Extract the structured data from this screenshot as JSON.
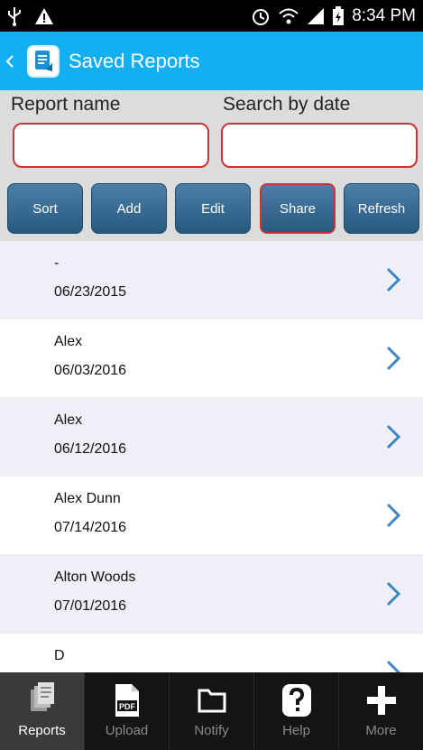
{
  "status_bar": {
    "time": "8:34 PM",
    "icons": [
      "usb-icon",
      "warning-icon",
      "alarm-icon",
      "wifi-icon",
      "signal-icon",
      "battery-icon"
    ]
  },
  "header": {
    "title": "Saved Reports"
  },
  "search": {
    "report_name_label": "Report name",
    "report_name_value": "",
    "date_label": "Search by date",
    "date_value": ""
  },
  "actions": {
    "sort": "Sort",
    "add": "Add",
    "edit": "Edit",
    "share": "Share",
    "refresh": "Refresh",
    "selected": "share"
  },
  "reports": [
    {
      "name": "-",
      "date": "06/23/2015"
    },
    {
      "name": "Alex",
      "date": "06/03/2016"
    },
    {
      "name": "Alex",
      "date": "06/12/2016"
    },
    {
      "name": "Alex Dunn",
      "date": "07/14/2016"
    },
    {
      "name": "Alton Woods",
      "date": "07/01/2016"
    },
    {
      "name": "D",
      "date": ""
    }
  ],
  "nav": {
    "reports": "Reports",
    "upload": "Upload",
    "notify": "Notify",
    "help": "Help",
    "more": "More",
    "active": "reports",
    "upload_icon_text": "PDF"
  },
  "colors": {
    "header_bg": "#12aff2",
    "button_bg": "#28597f",
    "selected_border": "#c93434",
    "row_alt_bg": "#efeff7",
    "chevron": "#3d86c6"
  }
}
